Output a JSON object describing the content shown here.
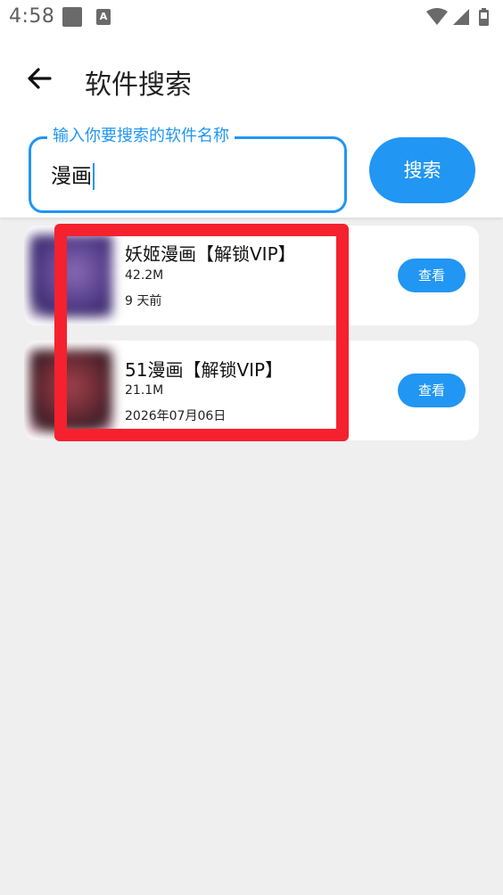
{
  "status_bar": {
    "time": "4:58",
    "notification_icons": [
      "square-icon",
      "a-icon"
    ],
    "system_icons": [
      "wifi-icon",
      "signal-icon",
      "battery-icon"
    ]
  },
  "app_bar": {
    "title": "软件搜索",
    "back_icon": "back-arrow-icon"
  },
  "search": {
    "label": "输入你要搜索的软件名称",
    "value": "漫画",
    "button_label": "搜索"
  },
  "results": [
    {
      "name": "妖姬漫画【解锁VIP】",
      "size": "42.2M",
      "date": "9 天前",
      "button_label": "查看"
    },
    {
      "name": "51漫画【解锁VIP】",
      "size": "21.1M",
      "date": "2026年07月06日",
      "button_label": "查看"
    }
  ],
  "colors": {
    "accent": "#2196f3",
    "highlight": "#f5212e",
    "background": "#efefef"
  }
}
